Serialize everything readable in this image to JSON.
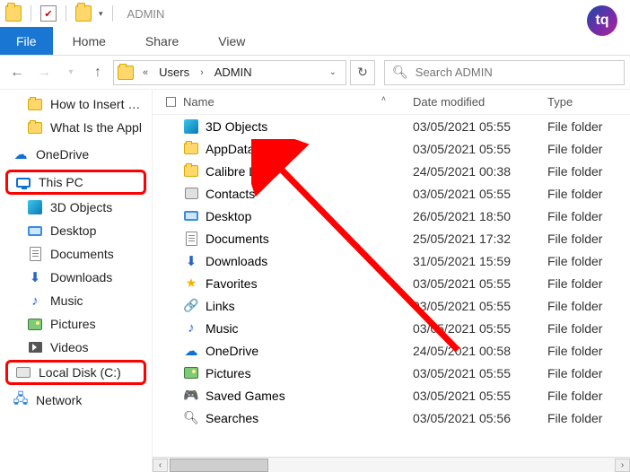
{
  "window": {
    "title": "ADMIN"
  },
  "ribbon": {
    "file": "File",
    "tabs": [
      "Home",
      "Share",
      "View"
    ]
  },
  "nav": {
    "path": [
      "Users",
      "ADMIN"
    ],
    "search_placeholder": "Search ADMIN"
  },
  "columns": {
    "name": "Name",
    "date": "Date modified",
    "type": "Type"
  },
  "tree": [
    {
      "label": "How to Insert a S",
      "icon": "folder",
      "indent": 1
    },
    {
      "label": "What Is the Appl",
      "icon": "folder",
      "indent": 1
    },
    {
      "label": "OneDrive",
      "icon": "cloud",
      "indent": 0,
      "top": true
    },
    {
      "label": "This PC",
      "icon": "pc",
      "indent": 0,
      "top": true,
      "hl": true
    },
    {
      "label": "3D Objects",
      "icon": "3d",
      "indent": 1
    },
    {
      "label": "Desktop",
      "icon": "desk",
      "indent": 1
    },
    {
      "label": "Documents",
      "icon": "doc",
      "indent": 1
    },
    {
      "label": "Downloads",
      "icon": "down",
      "indent": 1
    },
    {
      "label": "Music",
      "icon": "music",
      "indent": 1
    },
    {
      "label": "Pictures",
      "icon": "pic",
      "indent": 1
    },
    {
      "label": "Videos",
      "icon": "video",
      "indent": 1
    },
    {
      "label": "Local Disk (C:)",
      "icon": "disk",
      "indent": 1,
      "hl": true
    },
    {
      "label": "Network",
      "icon": "net",
      "indent": 0,
      "top": true
    }
  ],
  "rows": [
    {
      "name": "3D Objects",
      "icon": "3d",
      "date": "03/05/2021 05:55",
      "type": "File folder"
    },
    {
      "name": "AppData",
      "icon": "folder",
      "date": "03/05/2021 05:55",
      "type": "File folder"
    },
    {
      "name": "Calibre Li",
      "icon": "folder",
      "date": "24/05/2021 00:38",
      "type": "File folder",
      "trunc": true
    },
    {
      "name": "Contacts",
      "icon": "contacts",
      "date": "03/05/2021 05:55",
      "type": "File folder"
    },
    {
      "name": "Desktop",
      "icon": "desk",
      "date": "26/05/2021 18:50",
      "type": "File folder"
    },
    {
      "name": "Documents",
      "icon": "doc",
      "date": "25/05/2021 17:32",
      "type": "File folder"
    },
    {
      "name": "Downloads",
      "icon": "down",
      "date": "31/05/2021 15:59",
      "type": "File folder"
    },
    {
      "name": "Favorites",
      "icon": "star",
      "date": "03/05/2021 05:55",
      "type": "File folder"
    },
    {
      "name": "Links",
      "icon": "link",
      "date": "03/05/2021 05:55",
      "type": "File folder"
    },
    {
      "name": "Music",
      "icon": "music",
      "date": "03/05/2021 05:55",
      "type": "File folder"
    },
    {
      "name": "OneDrive",
      "icon": "cloud",
      "date": "24/05/2021 00:58",
      "type": "File folder"
    },
    {
      "name": "Pictures",
      "icon": "pic",
      "date": "03/05/2021 05:55",
      "type": "File folder"
    },
    {
      "name": "Saved Games",
      "icon": "game",
      "date": "03/05/2021 05:55",
      "type": "File folder"
    },
    {
      "name": "Searches",
      "icon": "search",
      "date": "03/05/2021 05:56",
      "type": "File folder"
    }
  ],
  "badge": "tq"
}
